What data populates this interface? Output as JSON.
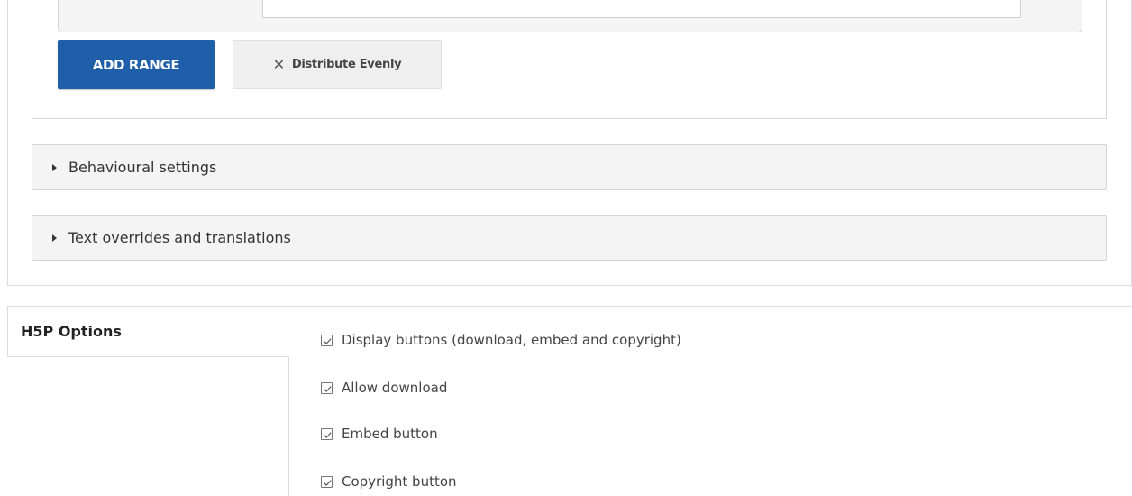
{
  "range_section": {
    "add_range_label": "ADD RANGE",
    "distribute_label": "Distribute Evenly",
    "distribute_icon": "close-icon"
  },
  "groups": [
    {
      "label": "Behavioural settings",
      "icon": "caret-right-icon"
    },
    {
      "label": "Text overrides and translations",
      "icon": "caret-right-icon"
    }
  ],
  "h5p_options": {
    "tab_label": "H5P Options",
    "options": [
      {
        "label": "Display buttons (download, embed and copyright)",
        "checked": true
      },
      {
        "label": "Allow download",
        "checked": true
      },
      {
        "label": "Embed button",
        "checked": true
      },
      {
        "label": "Copyright button",
        "checked": true
      }
    ]
  },
  "colors": {
    "primary_button": "#1f5ea8",
    "secondary_button": "#efefef",
    "group_background": "#f4f4f4"
  }
}
